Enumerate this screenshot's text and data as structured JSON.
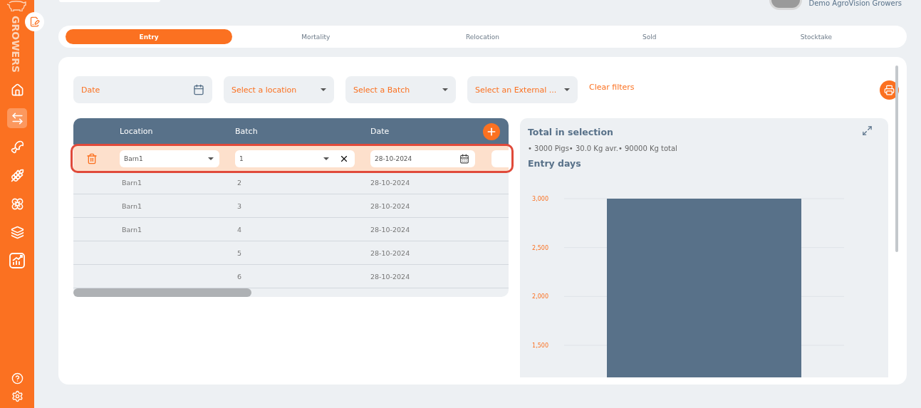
{
  "sidebar": {
    "brand": "GROWERS",
    "nav_items": [
      {
        "kind": "home",
        "selected": false
      },
      {
        "kind": "transfer",
        "selected": true
      },
      {
        "kind": "meat",
        "selected": false
      },
      {
        "kind": "grain",
        "selected": false
      },
      {
        "kind": "flower",
        "selected": false
      },
      {
        "kind": "layers",
        "selected": false
      },
      {
        "kind": "report",
        "selected": false
      }
    ],
    "footer_items": [
      {
        "kind": "help"
      },
      {
        "kind": "settings"
      }
    ]
  },
  "user": {
    "name": "Demo AgroVision Growers"
  },
  "tabs": [
    {
      "label": "Entry",
      "selected": true
    },
    {
      "label": "Mortality",
      "selected": false
    },
    {
      "label": "Relocation",
      "selected": false
    },
    {
      "label": "Sold",
      "selected": false
    },
    {
      "label": "Stocktake",
      "selected": false
    }
  ],
  "filters": [
    {
      "kind": "date",
      "placeholder": "Date"
    },
    {
      "kind": "select",
      "placeholder": "Select a location"
    },
    {
      "kind": "select",
      "placeholder": "Select a Batch"
    },
    {
      "kind": "select",
      "placeholder": "Select an External ..."
    }
  ],
  "clear_filters": "Clear filters",
  "table": {
    "columns": [
      "Location",
      "Batch",
      "Date"
    ],
    "edit_row": {
      "location": "Barn1",
      "batch": "1",
      "date": "28-10-2024"
    },
    "rows": [
      {
        "location": "Barn1",
        "batch": "2",
        "date": "28-10-2024"
      },
      {
        "location": "Barn1",
        "batch": "3",
        "date": "28-10-2024"
      },
      {
        "location": "Barn1",
        "batch": "4",
        "date": "28-10-2024"
      },
      {
        "batch": "5",
        "date": "28-10-2024"
      },
      {
        "batch": "6",
        "date": "28-10-2024"
      }
    ]
  },
  "summary": {
    "title": "Total in selection",
    "stats": "• 3000 Pigs• 30.0 Kg avr.• 90000 Kg total",
    "chart_title": "Entry days",
    "chart_data": {
      "type": "bar",
      "grid": true,
      "series": [
        {
          "color": "#587189",
          "values": [
            3000
          ]
        }
      ],
      "ylim": [
        0,
        3000
      ],
      "yticks": [
        {
          "value": 1500,
          "label": "1,500"
        },
        {
          "value": 2000,
          "label": "2,000"
        },
        {
          "value": 2500,
          "label": "2,500"
        },
        {
          "value": 3000,
          "label": "3,000"
        }
      ]
    }
  }
}
